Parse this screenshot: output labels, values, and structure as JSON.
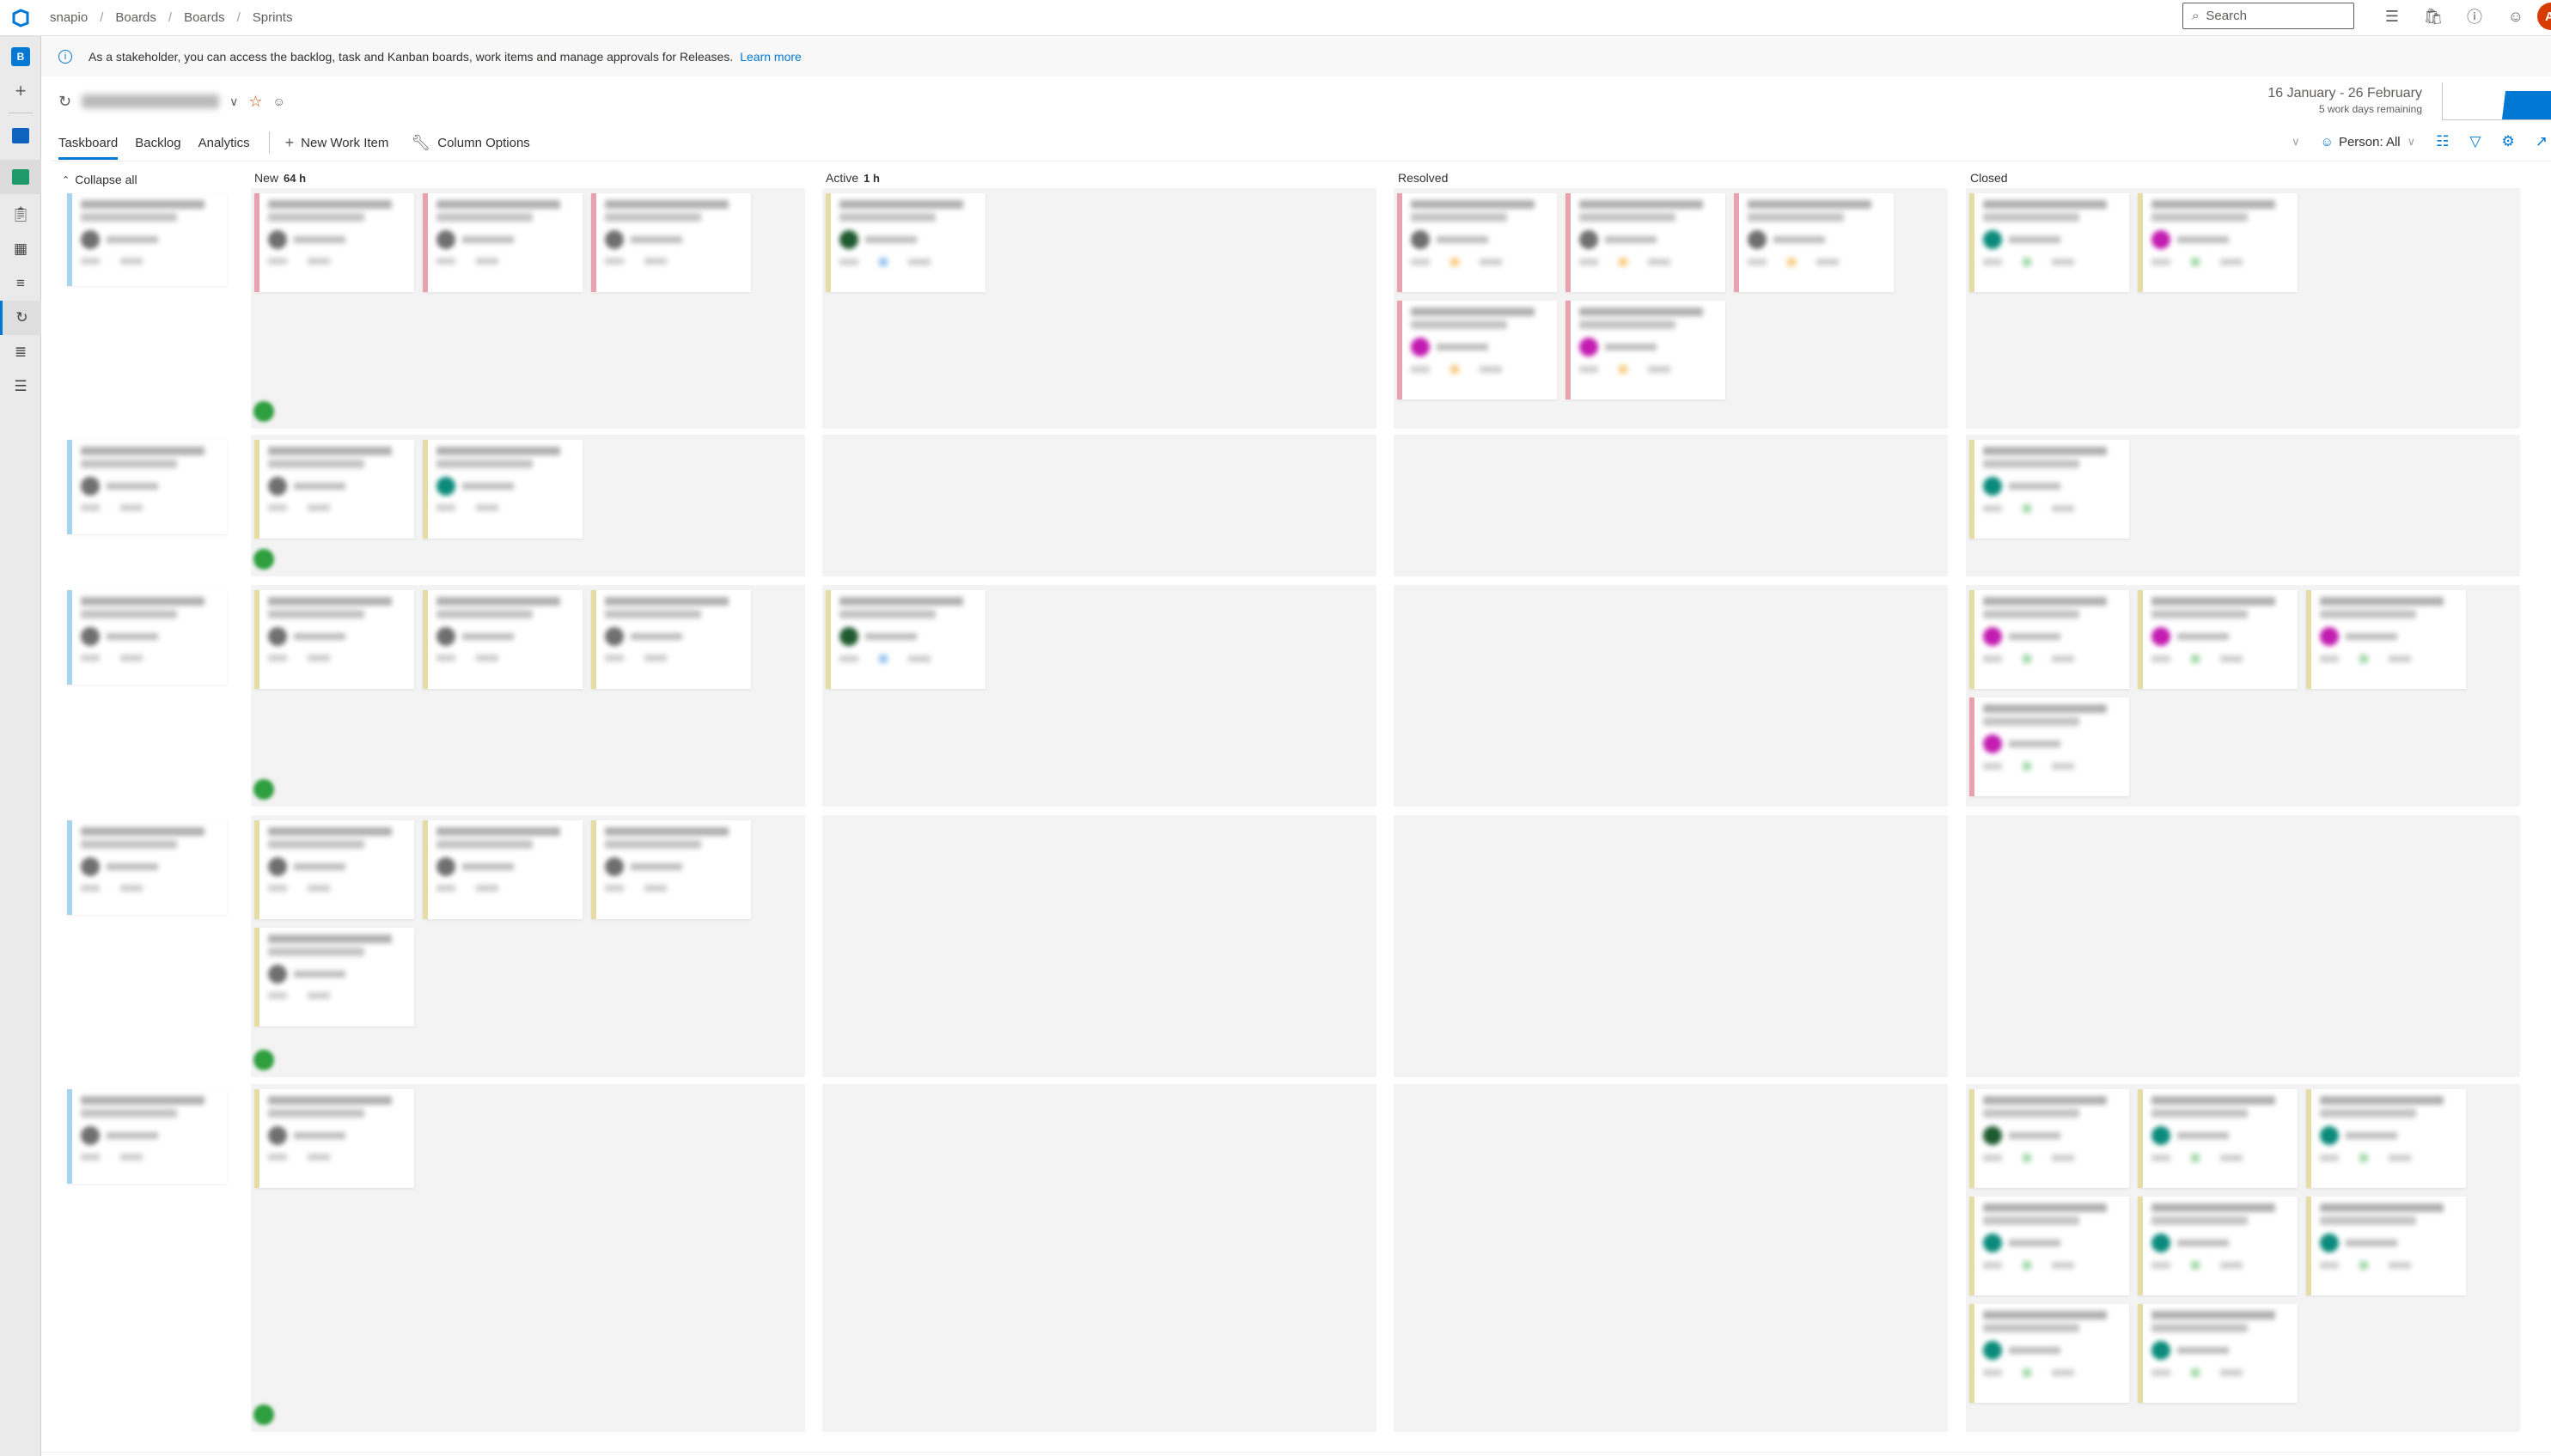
{
  "topbar": {
    "breadcrumb": [
      "snapio",
      "Boards",
      "Boards",
      "Sprints"
    ],
    "search_placeholder": "Search",
    "icons": [
      "task-list-icon",
      "shopping-bag-icon",
      "help-icon",
      "user-settings-icon"
    ],
    "avatar_initial": "A",
    "avatar_color": "#d83b01"
  },
  "leftnav": {
    "project_initial": "B",
    "items": [
      "add-icon",
      "overview-icon",
      "boards-icon",
      "work-items-icon",
      "boards-grid-icon",
      "backlogs-icon",
      "sprints-icon",
      "queries-icon",
      "delivery-plans-icon"
    ],
    "selected": "sprints-icon"
  },
  "banner": {
    "message": "As a stakeholder, you can access the backlog, task and Kanban boards, work items and manage approvals for Releases.",
    "link": "Learn more"
  },
  "sprint": {
    "name": "(redacted)",
    "date_range": "16 January - 26 February",
    "remaining": "5 work days remaining"
  },
  "tabs": [
    {
      "label": "Taskboard",
      "selected": true
    },
    {
      "label": "Backlog",
      "selected": false
    },
    {
      "label": "Analytics",
      "selected": false
    }
  ],
  "commands": {
    "new_work_item": "New Work Item",
    "column_options": "Column Options"
  },
  "toolbar_right": {
    "person_filter": "Person: All"
  },
  "board": {
    "collapse_all": "Collapse all",
    "columns": [
      {
        "name": "New",
        "work": "64 h"
      },
      {
        "name": "Active",
        "work": "1 h"
      },
      {
        "name": "Resolved",
        "work": ""
      },
      {
        "name": "Closed",
        "work": ""
      }
    ],
    "colors": {
      "bug": "#e8a1ad",
      "task": "#e6dca6",
      "pbi": "#a6d3ee",
      "avatar_gray": "#6f6f6f",
      "avatar_teal": "#0a8a7a",
      "avatar_magenta": "#c21cb0",
      "avatar_darkgreen": "#1e5a2e",
      "state_blue": "#9cc8f0",
      "state_orange": "#f8cf8a",
      "state_green": "#a8dcae"
    },
    "rows": [
      {
        "parent": {
          "type": "pbi",
          "avatar": "avatar_gray"
        },
        "cells": [
          [
            {
              "type": "bug",
              "avatar": "avatar_gray",
              "state": ""
            },
            {
              "type": "bug",
              "avatar": "avatar_gray",
              "state": ""
            },
            {
              "type": "bug",
              "avatar": "avatar_gray",
              "state": ""
            }
          ],
          [
            {
              "type": "task",
              "avatar": "avatar_darkgreen",
              "state": "state_blue"
            }
          ],
          [
            {
              "type": "bug",
              "avatar": "avatar_gray",
              "state": "state_orange"
            },
            {
              "type": "bug",
              "avatar": "avatar_gray",
              "state": "state_orange"
            },
            {
              "type": "bug",
              "avatar": "avatar_gray",
              "state": "state_orange"
            },
            {
              "type": "bug",
              "avatar": "avatar_magenta",
              "state": "state_orange"
            },
            {
              "type": "bug",
              "avatar": "avatar_magenta",
              "state": "state_orange"
            }
          ],
          [
            {
              "type": "task",
              "avatar": "avatar_teal",
              "state": "state_green"
            },
            {
              "type": "task",
              "avatar": "avatar_magenta",
              "state": "state_green"
            }
          ]
        ]
      },
      {
        "parent": {
          "type": "pbi",
          "avatar": "avatar_gray"
        },
        "cells": [
          [
            {
              "type": "task",
              "avatar": "avatar_gray",
              "state": ""
            },
            {
              "type": "task",
              "avatar": "avatar_teal",
              "state": ""
            }
          ],
          [],
          [],
          [
            {
              "type": "task",
              "avatar": "avatar_teal",
              "state": "state_green"
            }
          ]
        ]
      },
      {
        "parent": {
          "type": "pbi",
          "avatar": "avatar_gray"
        },
        "cells": [
          [
            {
              "type": "task",
              "avatar": "avatar_gray",
              "state": ""
            },
            {
              "type": "task",
              "avatar": "avatar_gray",
              "state": ""
            },
            {
              "type": "task",
              "avatar": "avatar_gray",
              "state": ""
            }
          ],
          [
            {
              "type": "task",
              "avatar": "avatar_darkgreen",
              "state": "state_blue"
            }
          ],
          [],
          [
            {
              "type": "task",
              "avatar": "avatar_magenta",
              "state": "state_green"
            },
            {
              "type": "task",
              "avatar": "avatar_magenta",
              "state": "state_green"
            },
            {
              "type": "task",
              "avatar": "avatar_magenta",
              "state": "state_green"
            },
            {
              "type": "bug",
              "avatar": "avatar_magenta",
              "state": "state_green"
            }
          ]
        ]
      },
      {
        "parent": {
          "type": "pbi",
          "avatar": "avatar_gray"
        },
        "cells": [
          [
            {
              "type": "task",
              "avatar": "avatar_gray",
              "state": ""
            },
            {
              "type": "task",
              "avatar": "avatar_gray",
              "state": ""
            },
            {
              "type": "task",
              "avatar": "avatar_gray",
              "state": ""
            },
            {
              "type": "task",
              "avatar": "avatar_gray",
              "state": ""
            }
          ],
          [],
          [],
          []
        ]
      },
      {
        "parent": {
          "type": "pbi",
          "avatar": "avatar_gray"
        },
        "cells": [
          [
            {
              "type": "task",
              "avatar": "avatar_gray",
              "state": ""
            }
          ],
          [],
          [],
          [
            {
              "type": "task",
              "avatar": "avatar_darkgreen",
              "state": "state_green"
            },
            {
              "type": "task",
              "avatar": "avatar_teal",
              "state": "state_green"
            },
            {
              "type": "task",
              "avatar": "avatar_teal",
              "state": "state_green"
            },
            {
              "type": "task",
              "avatar": "avatar_teal",
              "state": "state_green"
            },
            {
              "type": "task",
              "avatar": "avatar_teal",
              "state": "state_green"
            },
            {
              "type": "task",
              "avatar": "avatar_teal",
              "state": "state_green"
            },
            {
              "type": "task",
              "avatar": "avatar_teal",
              "state": "state_green"
            },
            {
              "type": "task",
              "avatar": "avatar_teal",
              "state": "state_green"
            }
          ]
        ]
      }
    ]
  }
}
